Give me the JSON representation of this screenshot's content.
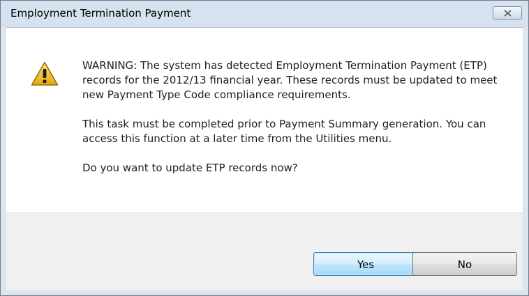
{
  "dialog": {
    "title": "Employment Termination Payment",
    "icon": "warning-icon",
    "message_paragraphs": [
      "WARNING: The system has detected Employment Termination Payment (ETP) records for the 2012/13 financial year.  These records must be updated to meet new Payment Type Code compliance requirements.",
      "This task must be completed prior to Payment Summary generation. You can access this function at a later time from the Utilities menu.",
      "Do you want to update ETP records now?"
    ],
    "buttons": {
      "yes": "Yes",
      "no": "No"
    }
  },
  "colors": {
    "titlebar": "#d6e2f0",
    "content_bg": "#ffffff",
    "footer_bg": "#f0f0f0",
    "default_button_border": "#3c7fb1",
    "warning_yellow": "#f5c623"
  }
}
